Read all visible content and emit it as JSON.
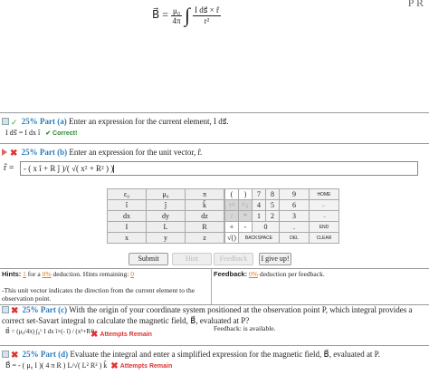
{
  "header_equation": {
    "lhs": "B⃗ =",
    "frac_num": "μ₀",
    "frac_den": "4π",
    "integral": "∫",
    "inner_num": "I ds⃗ × r̂",
    "inner_den": "r²",
    "corner_text": "P  R"
  },
  "part_a": {
    "percent": "25%",
    "label": "Part (a)",
    "prompt": "Enter an expression for the current element, I ds⃗.",
    "answer": "I ds⃗ = I dx î",
    "status": "✔ Correct!"
  },
  "part_b": {
    "percent": "25%",
    "label": "Part (b)",
    "prompt": "Enter an expression for the unit vector, r̂.",
    "input_label": "r̂ =",
    "input_value": "- ( x î + R ĵ )/( √( x² + R² ) )"
  },
  "keypad_left": [
    [
      "ε₀",
      "μ₀",
      "π"
    ],
    [
      "î",
      "ĵ",
      "k̂"
    ],
    [
      "dx",
      "dy",
      "dz"
    ],
    [
      "I",
      "L",
      "R"
    ],
    [
      "x",
      "y",
      "z"
    ]
  ],
  "keypad_right": [
    [
      "(",
      ")",
      "7",
      "8",
      "9",
      "HOME"
    ],
    [
      "↑^",
      "^↓",
      "4",
      "5",
      "6",
      "←"
    ],
    [
      "/",
      "*",
      "1",
      "2",
      "3",
      "→"
    ],
    [
      "+",
      "-",
      "0",
      ".",
      "END"
    ],
    [
      "√()",
      "BACKSPACE",
      "DEL",
      "CLEAR"
    ]
  ],
  "buttons": {
    "submit": "Submit",
    "hint": "Hint",
    "feedback": "Feedback",
    "give_up": "I give up!"
  },
  "hints_bar": {
    "label": "Hints:",
    "used": "1",
    "for_a": "for a",
    "deduction": "0%",
    "deduction_text": "deduction. Hints remaining:",
    "remaining": "0"
  },
  "feedback_bar": {
    "label": "Feedback:",
    "deduction": "0%",
    "deduction_text": "deduction per feedback."
  },
  "hint_message": "-This unit vector indicates the direction from the current element to the observation point.",
  "part_c": {
    "percent": "25%",
    "label": "Part (c)",
    "prompt": "With the origin of your coordinate system positioned at the observation point P, which integral provides a correct set-Savart integral to calculate the magnetic field, B⃗, evaluated at P?",
    "answer": "B⃗ = (μ₀/4π) ∫₀ᴸ I dx î×(- î) / (x²+R²)",
    "feedback": "Feedback: is available.",
    "status": "Attempts Remain"
  },
  "part_d": {
    "percent": "25%",
    "label": "Part (d)",
    "prompt": "Evaluate the integral and enter a simplified expression for the magnetic field, B⃗, evaluated at P.",
    "answer": "B⃗ = - ( μ₀ I )( 4 π R ) L/√( L² R² ) k̂",
    "status": "Attempts Remain"
  }
}
